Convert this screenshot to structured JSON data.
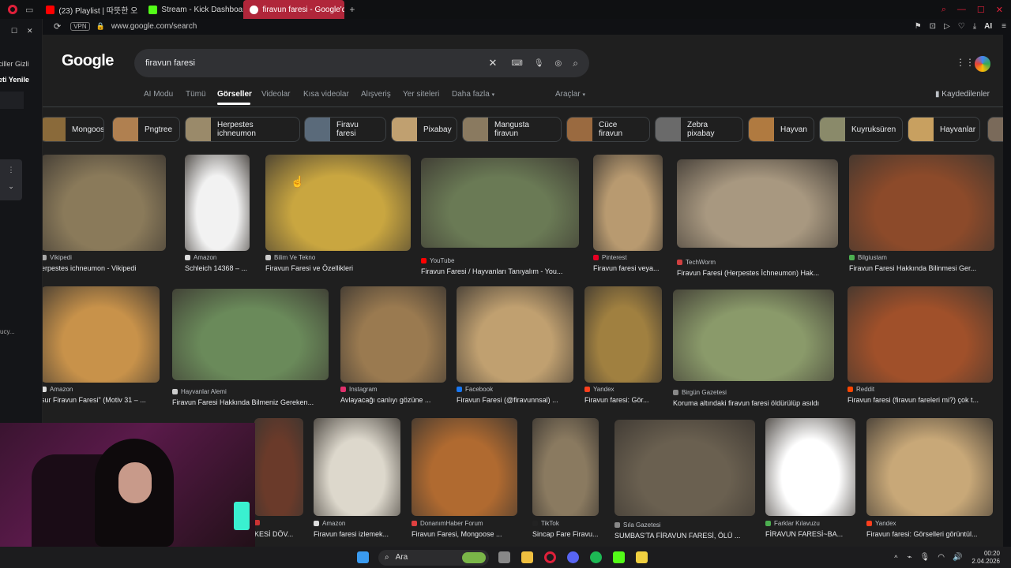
{
  "browser": {
    "tabs": [
      {
        "label": "(23) Playlist | 따뜻한 오",
        "color": "#ff0000"
      },
      {
        "label": "Stream - Kick Dashboard",
        "color": "#53fc18"
      },
      {
        "label": "firavun faresi - Google'da",
        "color": "#ffffff"
      }
    ],
    "vpn_label": "VPN",
    "url": "www.google.com/search",
    "ai_label": "AI"
  },
  "left_panel": {
    "text1": "ciller Gizli",
    "text2": "eti Yenile",
    "text3": "ucy..."
  },
  "google": {
    "logo": "Google",
    "query": "firavun faresi",
    "nav_tabs": [
      "AI Modu",
      "Tümü",
      "Görseller",
      "Videolar",
      "Kısa videolar",
      "Alışveriş",
      "Yer siteleri",
      "Daha fazla"
    ],
    "tools": "Araçlar",
    "saved": "Kaydedilenler",
    "chips": [
      "Mongoose",
      "Pngtree",
      "Herpestes ichneumon",
      "Firavu faresi",
      "Pixabay",
      "Mangusta firavun",
      "Cüce firavun",
      "Zebra pixabay",
      "Hayvan",
      "Kuyruksüren",
      "Hayvanlar"
    ],
    "results": [
      {
        "source": "Vikipedi",
        "title": "erpestes ichneumon - Vikipedi",
        "color": "#8a7a5a",
        "icon": "#aaaaaa"
      },
      {
        "source": "Amazon",
        "title": "Schleich 14368 – ...",
        "color": "#f2f2f2",
        "icon": "#dddddd"
      },
      {
        "source": "Bilim Ve Tekno",
        "title": "Firavun Faresi ve Özellikleri",
        "color": "#c9a640",
        "icon": "#cccccc"
      },
      {
        "source": "YouTube",
        "title": "Firavun Faresi / Hayvanları Tanıyalım - You...",
        "color": "#6a7a55",
        "icon": "#ff0000"
      },
      {
        "source": "Pinterest",
        "title": "Firavun faresi veya...",
        "color": "#b89a70",
        "icon": "#e60023"
      },
      {
        "source": "TechWorm",
        "title": "Firavun Faresi (Herpestes İchneumon) Hak...",
        "color": "#a89880",
        "icon": "#d04040"
      },
      {
        "source": "Bilgiustam",
        "title": "Firavun Faresi Hakkında Bilinmesi Ger...",
        "color": "#8c4a2a",
        "icon": "#4caf50"
      },
      {
        "source": "Amazon",
        "title": "sur Firavun Faresi\" (Motiv 31 – ...",
        "color": "#c8924a",
        "icon": "#dddddd"
      },
      {
        "source": "Hayvanlar Alemi",
        "title": "Firavun Faresi Hakkında Bilmeniz Gereken...",
        "color": "#6a8a5a",
        "icon": "#cccccc"
      },
      {
        "source": "Instagram",
        "title": "Avlayacağı canlıyı gözüne ...",
        "color": "#9a7a50",
        "icon": "#e1306c"
      },
      {
        "source": "Facebook",
        "title": "Firavun Faresi (@firavunnsal) ...",
        "color": "#c0a070",
        "icon": "#1877f2"
      },
      {
        "source": "Yandex",
        "title": "Firavun faresi: Gör...",
        "color": "#a08040",
        "icon": "#fc3f1d"
      },
      {
        "source": "Birgün Gazetesi",
        "title": "Koruma altındaki firavun faresi öldürülüp asıldı",
        "color": "#8a9a6a",
        "icon": "#888888"
      },
      {
        "source": "Reddit",
        "title": "Firavun faresi (firavun fareleri mi?) çok t...",
        "color": "#a0502a",
        "icon": "#ff4500"
      },
      {
        "source": "",
        "title": "KESİ DÖV...",
        "color": "#6a3a2a",
        "icon": "#cc3333"
      },
      {
        "source": "Amazon",
        "title": "Firavun faresi izlemek...",
        "color": "#ddd8cc",
        "icon": "#dddddd"
      },
      {
        "source": "DonanımHaber Forum",
        "title": "Firavun Faresi, Mongoose ...",
        "color": "#b06a30",
        "icon": "#e04040"
      },
      {
        "source": "TikTok",
        "title": "Sincap Fare Firavu...",
        "color": "#8a7a60",
        "icon": "#222222"
      },
      {
        "source": "Sıla Gazetesi",
        "title": "SUMBAS'TA FİRAVUN FARESİ, ÖLÜ ...",
        "color": "#6a6050",
        "icon": "#888888"
      },
      {
        "source": "Farklar Kılavuzu",
        "title": "FİRAVUN FARESİ~BA...",
        "color": "#ffffff",
        "icon": "#4caf50"
      },
      {
        "source": "Yandex",
        "title": "Firavun faresi: Görselleri görüntül...",
        "color": "#c8a878",
        "icon": "#fc3f1d"
      }
    ]
  },
  "taskbar": {
    "search": "Ara",
    "time": "00:20",
    "date": "2.04.2026"
  }
}
